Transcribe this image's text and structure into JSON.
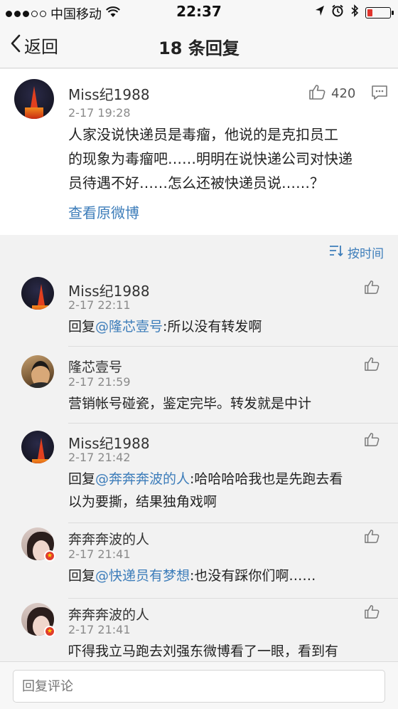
{
  "status_bar": {
    "carrier": "中国移动",
    "time": "22:37"
  },
  "nav": {
    "back_label": "返回",
    "title": "18 条回复"
  },
  "main_post": {
    "user": "Miss纪1988",
    "time": "2-17 19:28",
    "likes": "420",
    "text_lines": [
      "人家没说快递员是毒瘤，他说的是克扣员工",
      "的现象为毒瘤吧……明明在说快递公司对快递",
      "员待遇不好……怎么还被快递员说……？"
    ],
    "view_original": "查看原微博"
  },
  "sort": {
    "label": "按时间"
  },
  "replies": [
    {
      "user": "Miss纪1988",
      "time": "2-17 22:11",
      "prefix": "回复",
      "mention": "@隆芯壹号",
      "text": ":所以没有转发啊"
    },
    {
      "user": "隆芯壹号",
      "time": "2-17 21:59",
      "text": "营销帐号碰瓷，鉴定完毕。转发就是中计"
    },
    {
      "user": "Miss纪1988",
      "time": "2-17 21:42",
      "prefix": "回复",
      "mention": "@奔奔奔波的人",
      "text": ":哈哈哈哈我也是先跑去看",
      "text2": "以为要撕，结果独角戏啊"
    },
    {
      "user": "奔奔奔波的人",
      "time": "2-17 21:41",
      "prefix": "回复",
      "mention": "@快递员有梦想",
      "text": ":也没有踩你们啊……"
    },
    {
      "user": "奔奔奔波的人",
      "time": "2-17 21:41",
      "text": "吓得我立马跑去刘强东微博看了一眼，看到有"
    }
  ],
  "input": {
    "placeholder": "回复评论"
  },
  "colors": {
    "link": "#3d7dba",
    "battery_low": "#e0342c"
  },
  "icons": [
    "location-icon",
    "alarm-icon",
    "bluetooth-icon",
    "battery-icon",
    "wifi-icon",
    "thumbs-up-icon",
    "comment-icon",
    "sort-icon",
    "back-chevron-icon"
  ]
}
